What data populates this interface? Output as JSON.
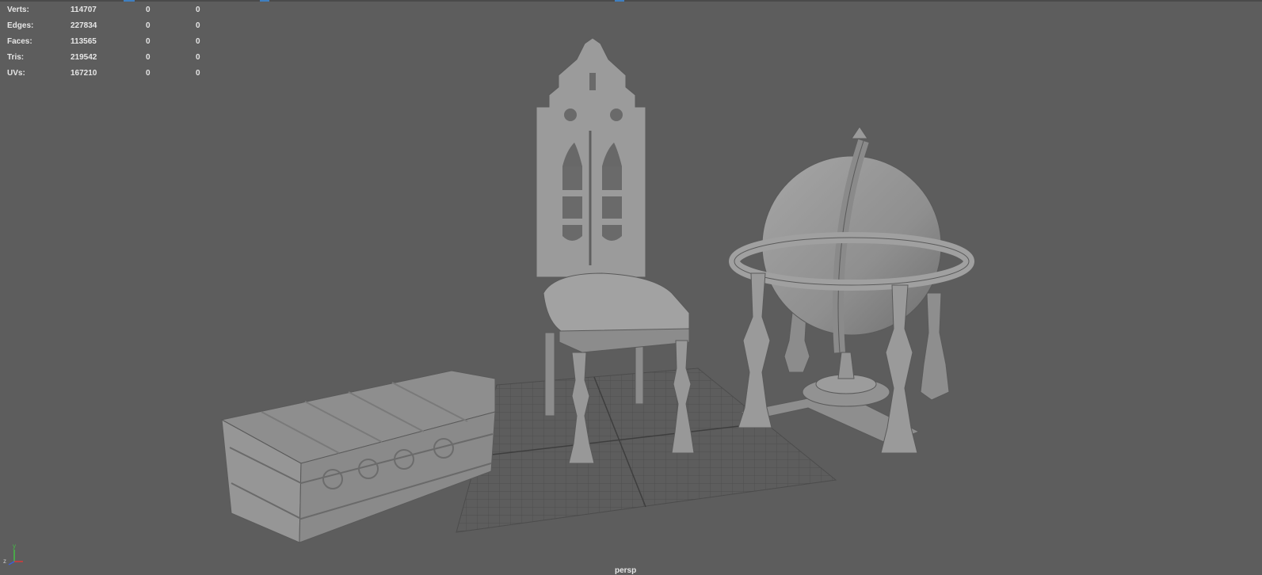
{
  "hud": {
    "rows": [
      {
        "label": "Verts:",
        "v1": "114707",
        "v2": "0",
        "v3": "0"
      },
      {
        "label": "Edges:",
        "v1": "227834",
        "v2": "0",
        "v3": "0"
      },
      {
        "label": "Faces:",
        "v1": "113565",
        "v2": "0",
        "v3": "0"
      },
      {
        "label": "Tris:",
        "v1": "219542",
        "v2": "0",
        "v3": "0"
      },
      {
        "label": "UVs:",
        "v1": "167210",
        "v2": "0",
        "v3": "0"
      }
    ]
  },
  "viewport": {
    "camera_name": "persp",
    "background_color": "#5d5d5d",
    "grid_color": "#4e4e4e",
    "model_color": "#9a9a9a"
  },
  "axis_gizmo": {
    "x_label": "x",
    "y_label": "y",
    "z_label": "z",
    "x_color": "#d93a3a",
    "y_color": "#44c044",
    "z_color": "#3b5fd9"
  },
  "scene_objects": {
    "chest_icon": "chest-model",
    "chair_icon": "gothic-chair-model",
    "globe_icon": "globe-model"
  }
}
